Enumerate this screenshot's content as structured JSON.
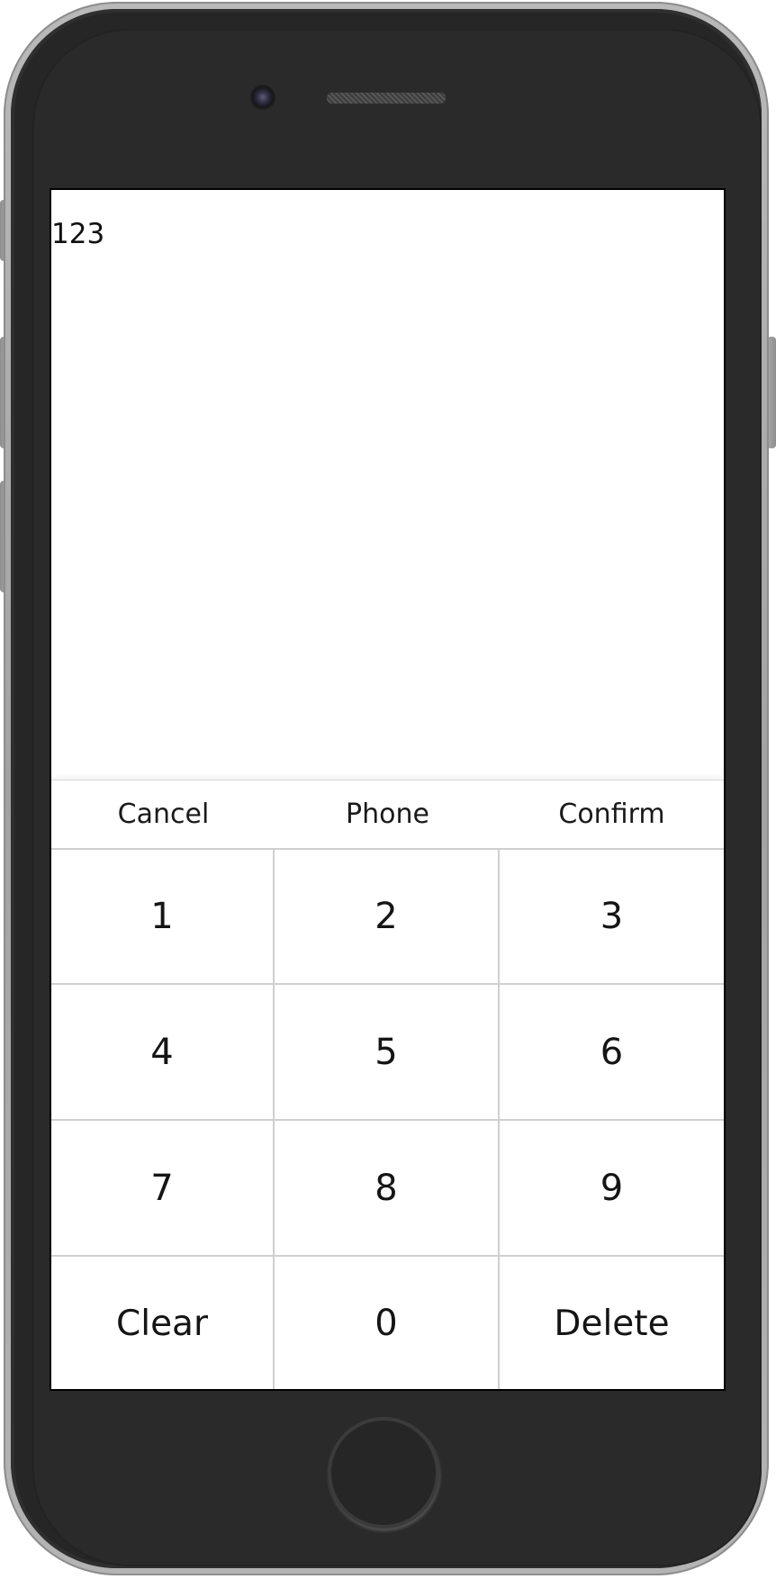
{
  "display": {
    "value": "123"
  },
  "keyboard": {
    "header": {
      "cancel_label": "Cancel",
      "mode_label": "Phone",
      "confirm_label": "Confirm"
    },
    "keys": [
      {
        "label": "1"
      },
      {
        "label": "2"
      },
      {
        "label": "3"
      },
      {
        "label": "4"
      },
      {
        "label": "5"
      },
      {
        "label": "6"
      },
      {
        "label": "7"
      },
      {
        "label": "8"
      },
      {
        "label": "9"
      },
      {
        "label": "Clear"
      },
      {
        "label": "0"
      },
      {
        "label": "Delete"
      }
    ]
  },
  "device": {
    "camera_icon": "camera-icon",
    "speaker_icon": "speaker-grille-icon",
    "home_icon": "home-button-icon",
    "body_color": "#262626",
    "rim_color": "#a9a9a9"
  }
}
